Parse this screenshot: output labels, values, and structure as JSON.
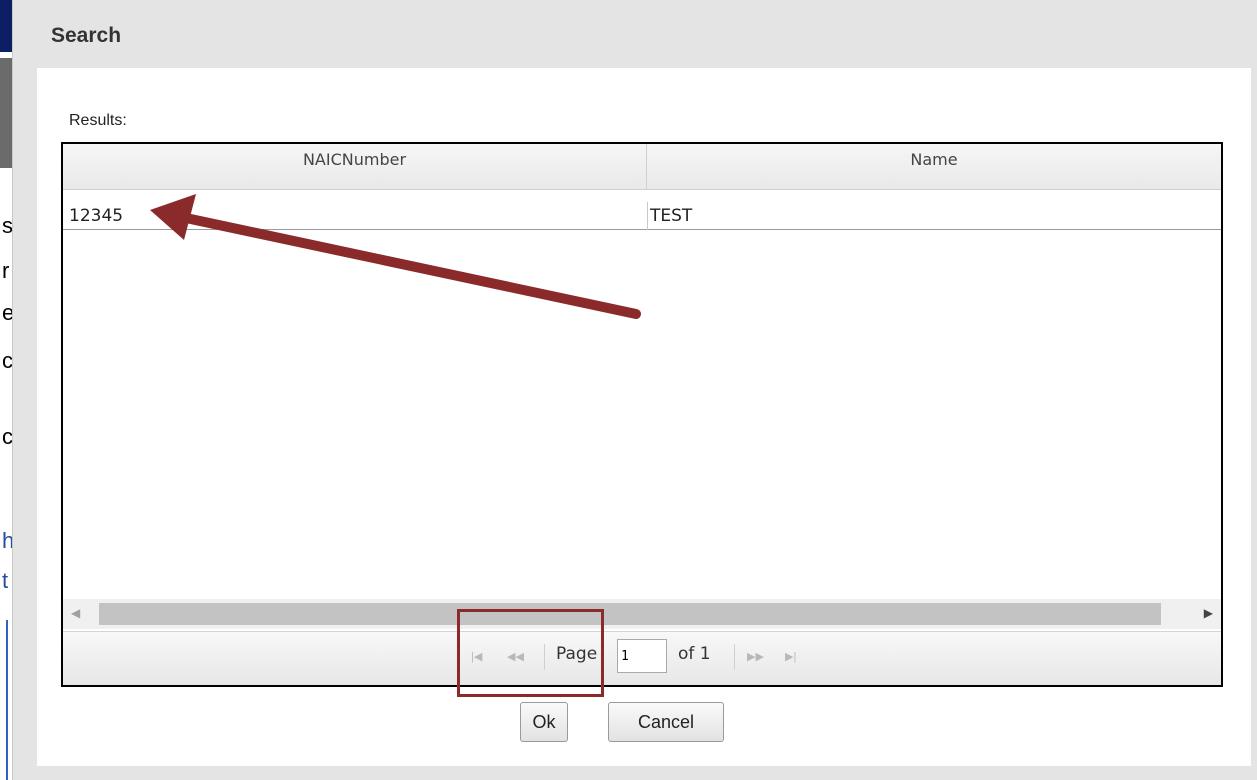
{
  "dialog": {
    "title": "Search",
    "results_label": "Results:"
  },
  "grid": {
    "columns": [
      "NAICNumber",
      "Name"
    ],
    "rows": [
      {
        "naic_number": "12345",
        "name": "TEST"
      }
    ]
  },
  "pager": {
    "page_label": "Page",
    "page_value": "1",
    "of_label": "of 1"
  },
  "buttons": {
    "ok_label": "Ok",
    "cancel_label": "Cancel"
  },
  "background_fragments": [
    "s",
    "r",
    "e",
    "c",
    "c",
    "h",
    "t"
  ],
  "colors": {
    "annotation": "#8b2a2a"
  }
}
